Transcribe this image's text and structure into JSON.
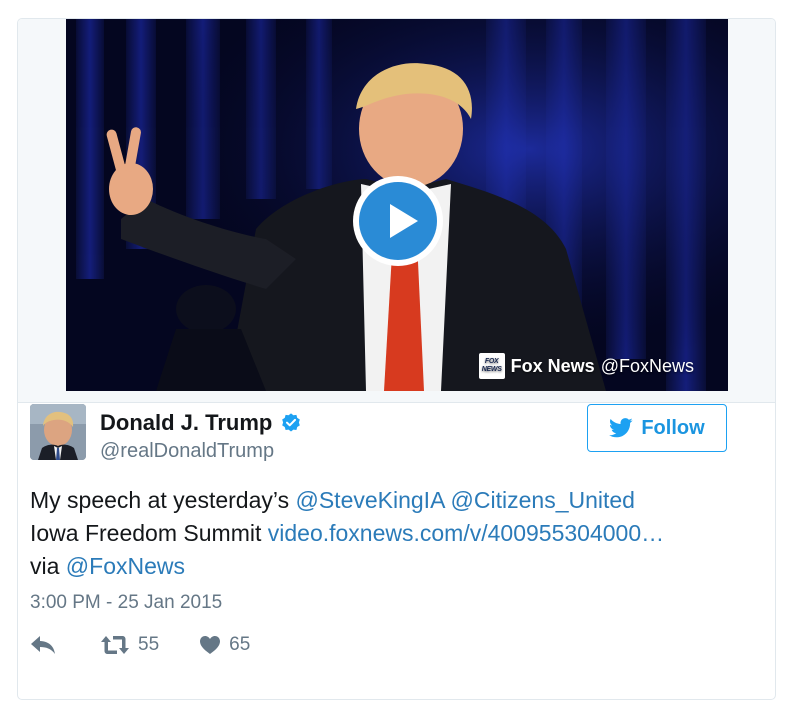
{
  "media": {
    "attribution_brand": "Fox News",
    "attribution_handle": "@FoxNews",
    "logo_text_top": "FOX",
    "logo_text_bottom": "NEWS",
    "play_icon": "play-icon"
  },
  "user": {
    "display_name": "Donald J. Trump",
    "handle": "@realDonaldTrump",
    "verified_icon": "verified-badge-icon"
  },
  "follow_button": {
    "label": "Follow",
    "icon": "twitter-bird-icon"
  },
  "tweet": {
    "text_1": "My speech at yesterday’s ",
    "mention_1": "@SteveKingIA",
    "mention_2": "@Citizens_United",
    "text_2": "Iowa Freedom Summit ",
    "link": "video.foxnews.com/v/400955304000…",
    "text_3": "via ",
    "mention_3": "@FoxNews"
  },
  "timestamp": "3:00 PM - 25 Jan 2015",
  "actions": {
    "reply_icon": "reply-icon",
    "retweet_icon": "retweet-icon",
    "retweet_count": "55",
    "like_icon": "heart-icon",
    "like_count": "65"
  },
  "colors": {
    "link": "#2b7bb9",
    "accent": "#1da1f2",
    "muted": "#657786"
  }
}
